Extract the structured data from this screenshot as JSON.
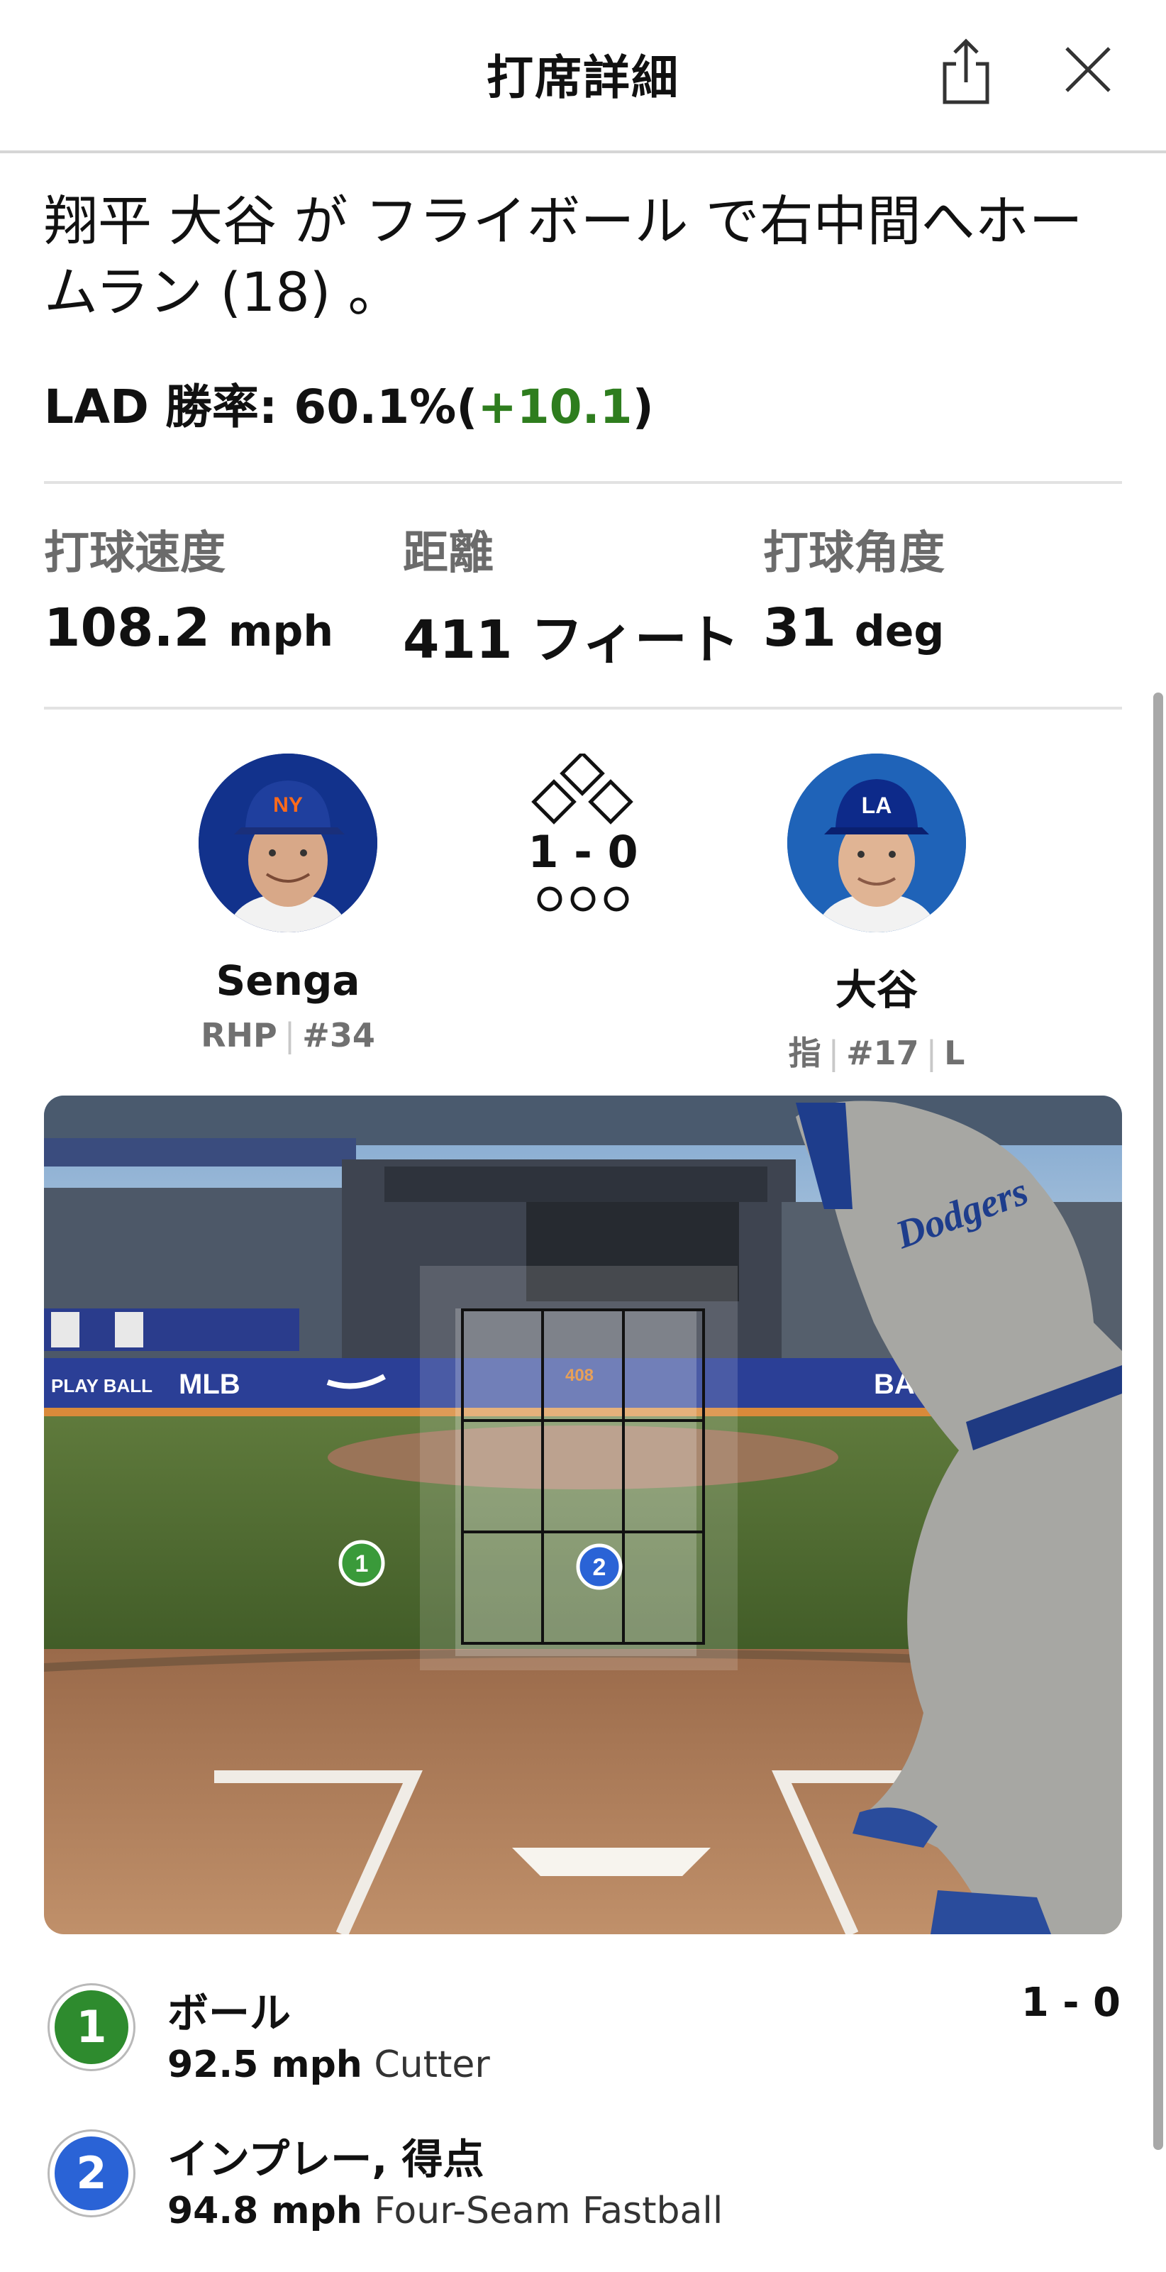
{
  "header": {
    "title": "打席詳細"
  },
  "headline": "翔平 大谷 が フライボール で右中間へホームラン (18) 。",
  "win_probability": {
    "team": "LAD",
    "label": "勝率:",
    "value": "60.1%",
    "open": "(",
    "delta": "+10.1",
    "close": ")"
  },
  "stats": [
    {
      "label": "打球速度",
      "value": "108.2",
      "unit": "mph"
    },
    {
      "label": "距離",
      "value": "411",
      "unit": "フィート"
    },
    {
      "label": "打球角度",
      "value": "31",
      "unit": "deg"
    }
  ],
  "pitcher": {
    "name": "Senga",
    "position": "RHP",
    "number": "#34",
    "team_logo": "NY"
  },
  "batter": {
    "name": "大谷",
    "position": "指",
    "number": "#17",
    "bats": "L",
    "team_logo": "LA"
  },
  "count": {
    "text": "1 - 0",
    "bases": [
      "empty",
      "empty",
      "empty"
    ],
    "outs": [
      false,
      false,
      false
    ]
  },
  "field": {
    "scoreboard_value": "408",
    "ad_texts": [
      "PLAY BALL",
      "MLB",
      "BA"
    ],
    "markers": [
      {
        "number": "1",
        "color": "#3a9a3a"
      },
      {
        "number": "2",
        "color": "#2a63d6"
      }
    ]
  },
  "pitches": [
    {
      "number": "1",
      "color": "#2e8b2e",
      "result": "ボール",
      "speed": "92.5 mph",
      "type": "Cutter",
      "count": "1 - 0"
    },
    {
      "number": "2",
      "color": "#2a63d6",
      "result": "インプレー, 得点",
      "speed": "94.8 mph",
      "type": "Four-Seam Fastball",
      "count": ""
    }
  ],
  "icons": [
    "share-icon",
    "close-icon",
    "bases-icon",
    "out-indicator-icon"
  ]
}
